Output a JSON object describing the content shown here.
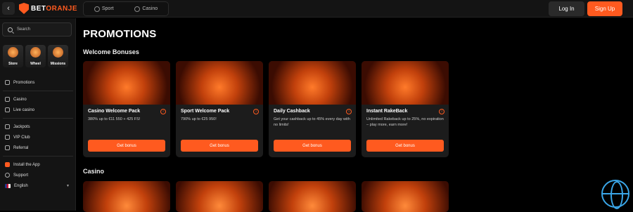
{
  "header": {
    "logo_text_a": "BET",
    "logo_text_b": "ORANJE",
    "modes": [
      "Sport",
      "Casino"
    ],
    "login_label": "Log In",
    "signup_label": "Sign Up",
    "accent_color": "#ff5a1f"
  },
  "sidebar": {
    "search_placeholder": "Search",
    "quick_links": [
      "Store",
      "Wheel",
      "Missions"
    ],
    "groups": [
      [
        "Promotions"
      ],
      [
        "Casino",
        "Live casino"
      ],
      [
        "Jackpots",
        "VIP Club",
        "Referral"
      ],
      [
        "Install the App",
        "Support",
        "English"
      ]
    ]
  },
  "main": {
    "page_title": "PROMOTIONS",
    "welcome_title": "Welcome Bonuses",
    "casino_title": "Casino",
    "cards": [
      {
        "title": "Casino Welcome Pack",
        "desc": "380% up to €11 550 + 425 FS!",
        "button": "Get bonus"
      },
      {
        "title": "Sport Welcome Pack",
        "desc": "790% up to €25 950!",
        "button": "Get bonus"
      },
      {
        "title": "Daily Cashback",
        "desc": "Get your cashback up to 45% every day with no limits!",
        "button": "Get bonus"
      },
      {
        "title": "Instant RakeBack",
        "desc": "Unlimited Rakeback up to 25%, no expiration – play more, earn more!",
        "button": "Get bonus"
      }
    ]
  }
}
